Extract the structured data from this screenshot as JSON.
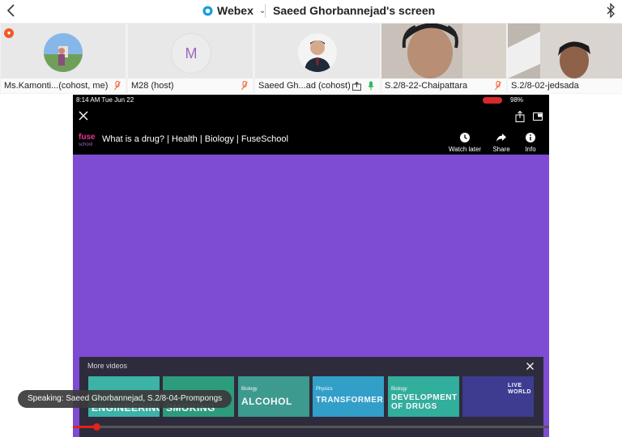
{
  "topbar": {
    "app_name": "Webex",
    "screen_title": "Saeed Ghorbannejad's screen"
  },
  "participants": [
    {
      "name": "Ms.Kamonti...(cohost, me)",
      "avatar": "photo",
      "muted": true
    },
    {
      "name": "M28 (host)",
      "avatar": "initial",
      "initial": "M",
      "muted": true
    },
    {
      "name": "Saeed Gh...ad (cohost)",
      "avatar": "photo",
      "muted": false,
      "sharing": true
    },
    {
      "name": "S.2/8-22-Chaipattara",
      "avatar": "video",
      "muted": true
    },
    {
      "name": "S.2/8-02-jedsada",
      "avatar": "video",
      "muted": false
    }
  ],
  "ipad_status": {
    "time": "8:14 AM   Tue Jun 22",
    "battery": "98%"
  },
  "video": {
    "title": "What is a drug? | Health | Biology | FuseSchool",
    "actions": [
      {
        "label": "Watch later",
        "icon": "clock-icon"
      },
      {
        "label": "Share",
        "icon": "share-arrow-icon"
      },
      {
        "label": "Info",
        "icon": "info-icon"
      }
    ],
    "progress": 0.05
  },
  "more_videos": {
    "title": "More videos",
    "items": [
      {
        "sub": "",
        "main": "ENGINEERING",
        "bg": "#3bb7a6"
      },
      {
        "sub": "",
        "main": "SMOKING",
        "bg": "#2aa07a"
      },
      {
        "sub": "Biology",
        "main": "ALCOHOL",
        "bg": "#3a9e8c"
      },
      {
        "sub": "Physics",
        "main": "TRANSFORMERS",
        "bg": "#2fa3c9"
      },
      {
        "sub": "Biology",
        "main": "DEVELOPMENT OF DRUGS",
        "bg": "#2eb39a"
      },
      {
        "sub": "",
        "main": "LIVE WORLD",
        "bg": "#3b3c8f"
      }
    ]
  },
  "toast": {
    "text": "Speaking: Saeed Ghorbannejad, S.2/8-04-Prompongs"
  },
  "colors": {
    "video_purple": "#7e4bd3",
    "mic_off": "#f05a28",
    "mic_on": "#2dba5a",
    "progress": "#e62117"
  }
}
